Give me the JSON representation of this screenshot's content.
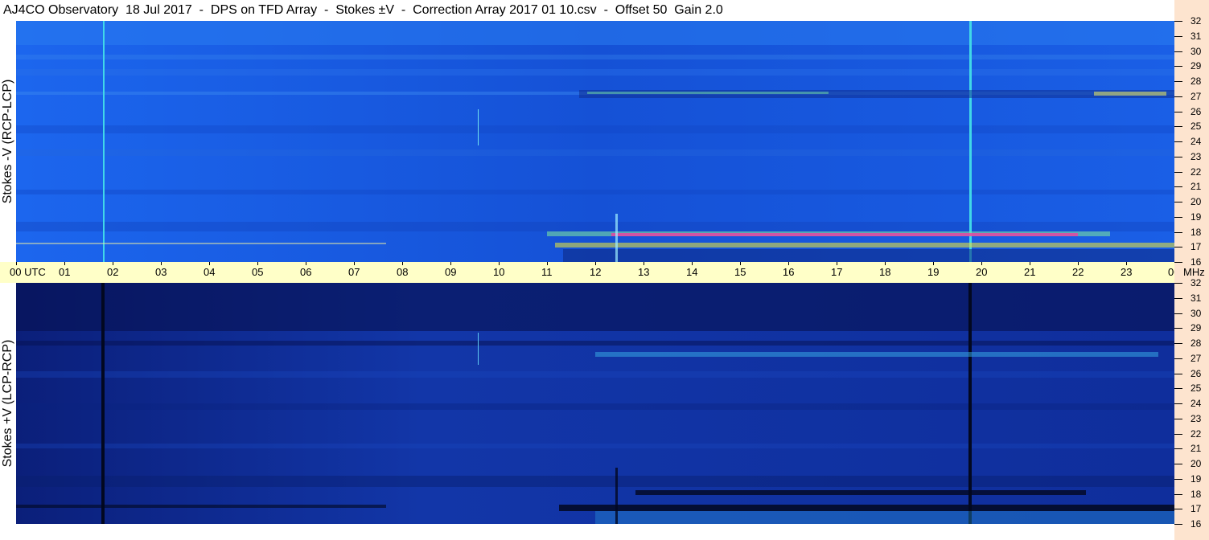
{
  "title": "AJ4CO Observatory  18 Jul 2017  -  DPS on TFD Array  -  Stokes ±V  -  Correction Array 2017 01 10.csv  -  Offset 50  Gain 2.0",
  "panels": {
    "top_ylabel": "Stokes -V (RCP-LCP)",
    "bottom_ylabel": "Stokes +V (LCP-RCP)"
  },
  "colors": {
    "top_background": "#1a5fe6",
    "bottom_background": "#0f2a96",
    "time_axis_band": "#ffffc8",
    "freq_axis_band": "#fde4cf"
  },
  "chart_data": {
    "type": "heatmap",
    "x_axis": {
      "labels": [
        "00 UTC",
        "01",
        "02",
        "03",
        "04",
        "05",
        "06",
        "07",
        "08",
        "09",
        "10",
        "11",
        "12",
        "13",
        "14",
        "15",
        "16",
        "17",
        "18",
        "19",
        "20",
        "21",
        "22",
        "23",
        "00"
      ],
      "range": [
        0,
        24
      ],
      "unit": "UTC"
    },
    "y_axis": {
      "labels": [
        "16",
        "17",
        "18",
        "19",
        "20",
        "21",
        "22",
        "23",
        "24",
        "25",
        "26",
        "27",
        "28",
        "29",
        "30",
        "31",
        "32"
      ],
      "range": [
        16,
        32
      ],
      "unit": "MHz"
    },
    "grid": false
  }
}
